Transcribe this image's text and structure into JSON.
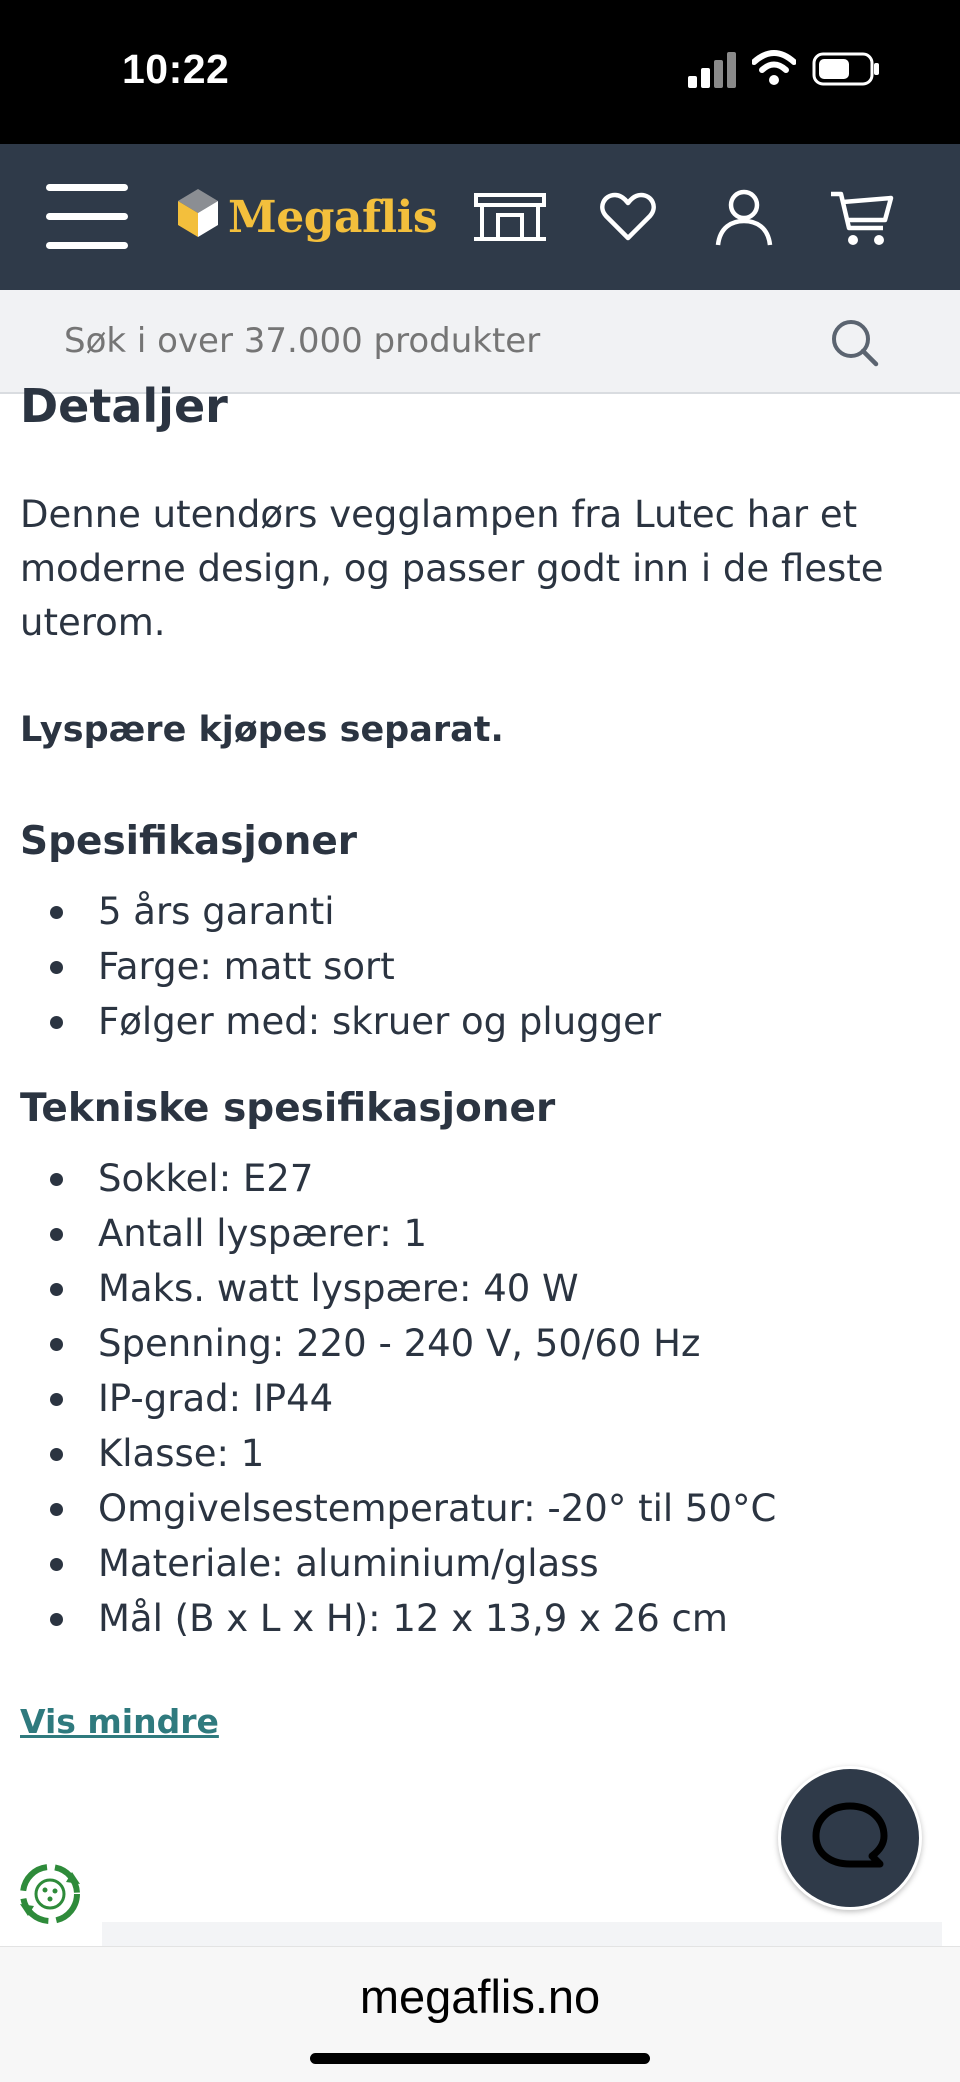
{
  "status_bar": {
    "time": "10:22"
  },
  "header": {
    "brand": "Megaflis",
    "icons": [
      "menu-icon",
      "store-icon",
      "heart-icon",
      "user-icon",
      "cart-icon"
    ]
  },
  "search": {
    "placeholder": "Søk i over 37.000 produkter"
  },
  "details": {
    "heading": "Detaljer",
    "description": "Denne utendørs vegglampen fra Lutec har et moderne design, og passer godt inn i de fleste uterom.",
    "note": "Lyspære kjøpes separat."
  },
  "specifications": {
    "heading": "Spesifikasjoner",
    "items": [
      "5 års garanti",
      "Farge: matt sort",
      "Følger med: skruer og plugger"
    ]
  },
  "technical": {
    "heading": "Tekniske spesifikasjoner",
    "items": [
      "Sokkel: E27",
      "Antall lyspærer: 1",
      "Maks. watt lyspære: 40 W",
      "Spenning: 220 - 240 V, 50/60 Hz",
      "IP-grad: IP44",
      "Klasse: 1",
      "Omgivelsestemperatur: -20° til 50°C",
      "Materiale: aluminium/glass",
      "Mål (B x L x H): 12 x 13,9 x 26 cm"
    ]
  },
  "toggle_label": "Vis mindre",
  "browser": {
    "url": "megaflis.no"
  },
  "colors": {
    "header_bg": "#2f3a49",
    "brand": "#f3bf3c",
    "link": "#2f7a7e",
    "text": "#2b3441"
  }
}
